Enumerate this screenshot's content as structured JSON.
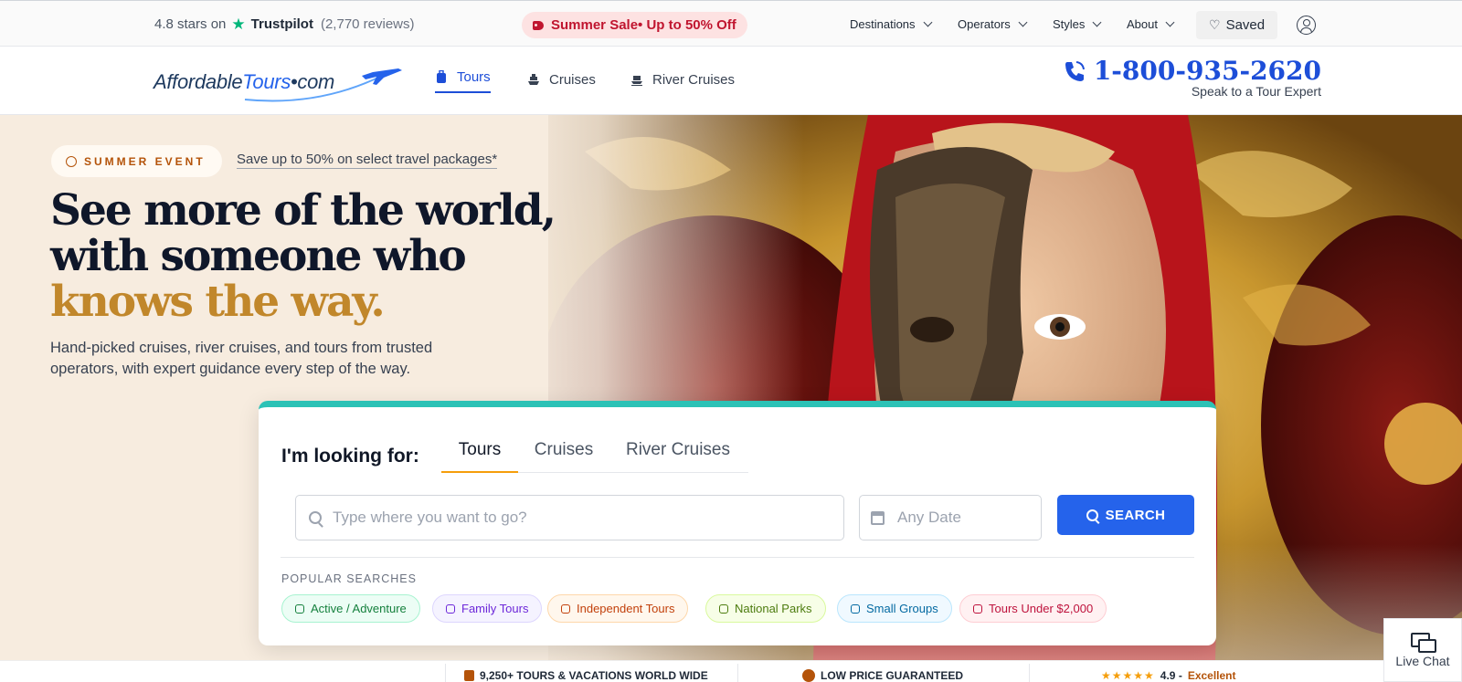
{
  "topbar": {
    "rating_text": "4.8 stars on",
    "trustpilot": "Trustpilot",
    "reviews": "(2,770 reviews)",
    "sale": "Summer Sale• Up to 50% Off",
    "nav": [
      "Destinations",
      "Operators",
      "Styles",
      "About"
    ],
    "saved": "Saved"
  },
  "header": {
    "logo_part1": "Affordable",
    "logo_part2": "Tours",
    "logo_part3": "•com",
    "nav": [
      {
        "label": "Tours",
        "icon": "suitcase-icon"
      },
      {
        "label": "Cruises",
        "icon": "ship-icon"
      },
      {
        "label": "River Cruises",
        "icon": "river-ship-icon"
      }
    ],
    "phone": "1-800-935-2620",
    "phone_sub": "Speak to a Tour Expert"
  },
  "hero": {
    "event_label": "SUMMER EVENT",
    "event_note": "Save up to 50% on select travel packages*",
    "headline_line1": "See more of the world,",
    "headline_line2": "with someone who",
    "headline_line3": "knows the way.",
    "subcopy": "Hand-picked cruises, river cruises, and tours from trusted operators, with expert guidance every step of the way."
  },
  "search": {
    "looking_for": "I'm looking for:",
    "tabs": [
      "Tours",
      "Cruises",
      "River Cruises"
    ],
    "active_tab": "Tours",
    "destination_placeholder": "Type where you want to go?",
    "date_placeholder": "Any Date",
    "button": "SEARCH",
    "popular_label": "POPULAR SEARCHES",
    "chips": [
      {
        "label": "Active / Adventure",
        "color": "#15803d",
        "bg": "#ecfdf5",
        "border": "#a7f3d0"
      },
      {
        "label": "Family Tours",
        "color": "#6d28d9",
        "bg": "#f5f3ff",
        "border": "#ddd6fe"
      },
      {
        "label": "Independent Tours",
        "color": "#c2410c",
        "bg": "#fff7ed",
        "border": "#fed7aa"
      },
      {
        "label": "National Parks",
        "color": "#4d7c0f",
        "bg": "#f7fee7",
        "border": "#d9f99d"
      },
      {
        "label": "Small Groups",
        "color": "#0369a1",
        "bg": "#f0f9ff",
        "border": "#bae6fd"
      },
      {
        "label": "Tours Under $2,000",
        "color": "#be123c",
        "bg": "#fff1f2",
        "border": "#fecdd3"
      }
    ]
  },
  "strip": {
    "item1": "9,250+ TOURS & VACATIONS WORLD WIDE",
    "item2": "LOW PRICE GUARANTEED",
    "rating": "4.9 -",
    "rating_word": "Excellent"
  },
  "livechat": "Live Chat",
  "colors": {
    "accent": "#2563eb",
    "gold": "#c1872b",
    "teal": "#2cc2b6",
    "sale": "#c0152f"
  }
}
